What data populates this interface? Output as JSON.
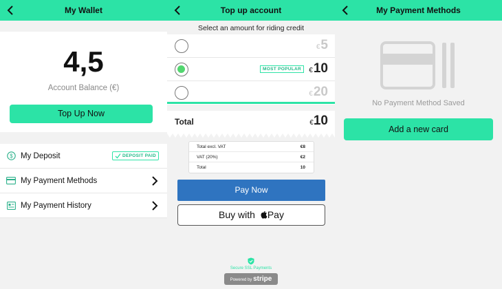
{
  "wallet": {
    "title": "My Wallet",
    "balance": "4,5",
    "balance_label": "Account Balance (€)",
    "topup_button": "Top Up Now",
    "menu": [
      {
        "label": "My Deposit",
        "icon": "dollar-icon",
        "badge": "DEPOSIT PAID"
      },
      {
        "label": "My Payment Methods",
        "icon": "card-icon"
      },
      {
        "label": "My Payment History",
        "icon": "receipt-icon"
      }
    ]
  },
  "topup": {
    "title": "Top up account",
    "instruction": "Select an amount for riding credit",
    "currency": "€",
    "options": [
      {
        "amount": "5",
        "selected": false
      },
      {
        "amount": "10",
        "selected": true,
        "badge": "MOST POPULAR"
      },
      {
        "amount": "20",
        "selected": false
      }
    ],
    "total_label": "Total",
    "total_value": "10",
    "breakdown": [
      {
        "label": "Total excl. VAT",
        "value": "€8"
      },
      {
        "label": "VAT (20%)",
        "value": "€2"
      },
      {
        "label": "Total",
        "value": "10"
      }
    ],
    "pay_now": "Pay Now",
    "buy_with": "Buy with",
    "apple_pay": "Pay",
    "secure_text": "Secure SSL Payments",
    "powered_by": "Powered by",
    "stripe": "stripe"
  },
  "methods": {
    "title": "My Payment Methods",
    "empty_text": "No Payment Method Saved",
    "add_button": "Add a new card"
  },
  "colors": {
    "accent": "#2ce3a6",
    "pay_blue": "#2f74c0",
    "radio_green": "#52d66f"
  }
}
